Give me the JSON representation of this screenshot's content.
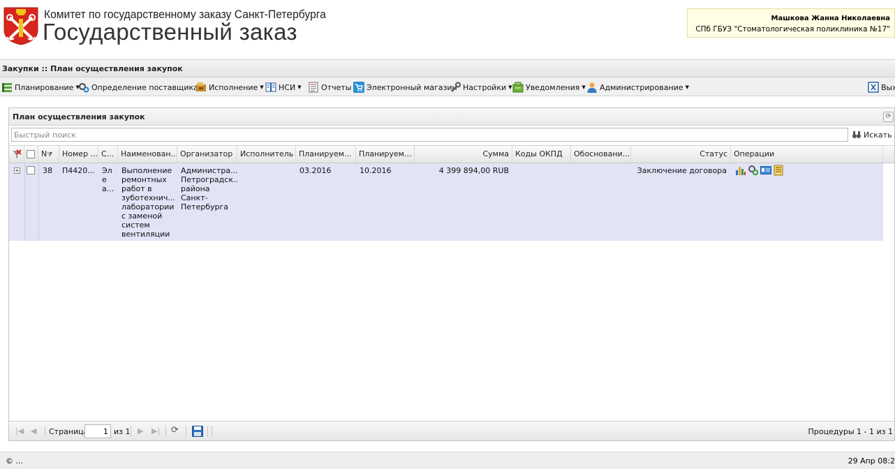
{
  "header": {
    "org_name": "Комитет по государственному заказу Санкт-Петербурга",
    "app_name": "Государственный заказ",
    "user_name": "Машкова Жанна Николаевна",
    "user_org": "СПб ГБУЗ \"Стоматологическая поликлиника №17\""
  },
  "breadcrumb": "Закупки :: План осуществления закупок",
  "menu": {
    "planning": "Планирование",
    "supplier": "Определение поставщика",
    "execution": "Исполнение",
    "nsi": "НСИ",
    "reports": "Отчеты",
    "shop": "Электронный магазин",
    "settings": "Настройки",
    "notifications": "Уведомления",
    "admin": "Администрирование",
    "exit": "Выход"
  },
  "panel": {
    "title": "План осуществления закупок",
    "search_placeholder": "Быстрый поиск",
    "search_button": "Искать"
  },
  "grid": {
    "columns": {
      "n": "N",
      "number": "Номер ...",
      "s": "С...",
      "name": "Наименован...",
      "organizer": "Организатор",
      "executor": "Исполнитель",
      "plan1": "Планируем...",
      "plan2": "Планируем...",
      "sum": "Сумма",
      "okpd": "Коды ОКПД",
      "basis": "Обосновани...",
      "status": "Статус",
      "ops": "Операции"
    },
    "rows": [
      {
        "n": "38",
        "number": "П4420...",
        "s": "Эле а...",
        "name": "Выполнение ремонтных работ в зуботехнич... лаборатории с заменой систем вентиляции",
        "organizer": "Администра... Петроградск... района Санкт-Петербурга",
        "executor": "",
        "plan1": "03.2016",
        "plan2": "10.2016",
        "sum": "4 399 894,00 RUB",
        "okpd": "",
        "basis": "",
        "status": "Заключение договора"
      }
    ]
  },
  "paging": {
    "page_label": "Страница",
    "page_value": "1",
    "of_label": "из 1",
    "summary": "Процедуры 1 - 1 из 1"
  },
  "status_bar": {
    "left": "© ...",
    "right": "29 Апр 08:2"
  },
  "colors": {
    "row_highlight": "#e2e4f6",
    "user_box": "#fffde3"
  }
}
